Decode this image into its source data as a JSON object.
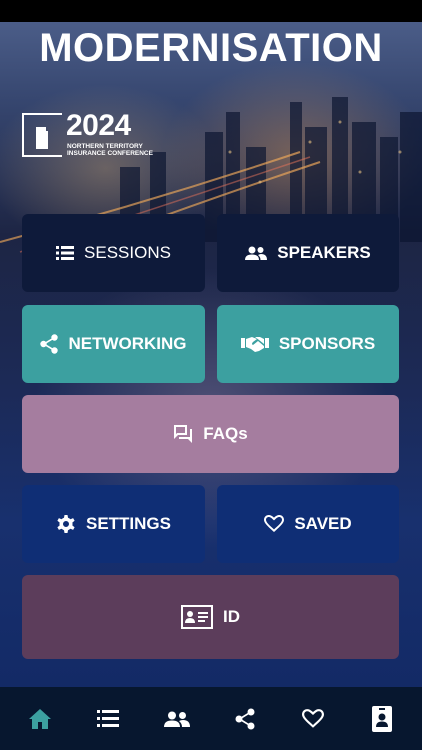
{
  "header": {
    "title": "MODERNISATION",
    "logo_year": "2024",
    "logo_subtitle": "NORTHERN TERRITORY INSURANCE CONFERENCE"
  },
  "menu": {
    "sessions": "SESSIONS",
    "speakers": "SPEAKERS",
    "networking": "NETWORKING",
    "sponsors": "SPONSORS",
    "faqs": "FAQs",
    "settings": "SETTINGS",
    "saved": "SAVED",
    "id": "ID"
  },
  "icons": {
    "sessions": "list-icon",
    "speakers": "people-icon",
    "networking": "share-icon",
    "sponsors": "handshake-icon",
    "faqs": "chat-bubbles-icon",
    "settings": "gear-icon",
    "saved": "heart-icon",
    "id": "id-card-icon"
  },
  "tabbar": {
    "items": [
      "home-icon",
      "list-icon",
      "people-icon",
      "share-icon",
      "heart-icon",
      "badge-icon"
    ],
    "active": "home"
  },
  "colors": {
    "dark_navy": "#0e1a3a",
    "teal": "#3ca0a0",
    "mauve": "#a57d9f",
    "royal_blue": "#0f2e75",
    "plum": "#5c3d5b",
    "tabbar": "#07172f"
  }
}
